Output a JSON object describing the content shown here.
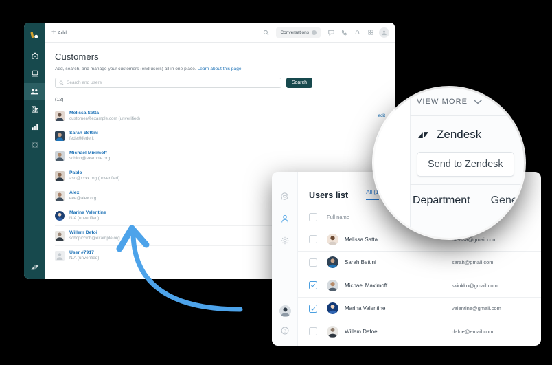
{
  "colors": {
    "nav_dark": "#17494d",
    "nav_active": "#2b5f63",
    "link_blue": "#1f73b7",
    "accent_blue": "#2b7cd3",
    "arrow_blue": "#4da3ea",
    "page_bg": "#000000"
  },
  "zendesk_window": {
    "nav": {
      "brand_icon": "zendesk-products-icon",
      "items": [
        {
          "icon": "home-icon",
          "name": "home",
          "active": false
        },
        {
          "icon": "views-icon",
          "name": "views",
          "active": false
        },
        {
          "icon": "customers-icon",
          "name": "customers",
          "active": true
        },
        {
          "icon": "organizations-icon",
          "name": "organizations",
          "active": false
        },
        {
          "icon": "reporting-icon",
          "name": "reporting",
          "active": false
        },
        {
          "icon": "admin-gear-icon",
          "name": "admin",
          "active": false
        }
      ],
      "footer_icon": "zendesk-logo-icon"
    },
    "topbar": {
      "add_label": "Add",
      "add_icon": "plus-icon",
      "search_icon": "search-icon",
      "conversations_label": "Conversations",
      "conversations_badge": "0",
      "icons": [
        "chat-icon",
        "phone-icon",
        "bell-icon",
        "apps-grid-icon"
      ],
      "avatar_icon": "user-avatar-icon"
    },
    "page": {
      "title": "Customers",
      "subtitle": "Add, search, and manage your customers (end users) all in one place.",
      "subtitle_link": "Learn about this page",
      "search_placeholder": "Search end users",
      "search_icon": "search-icon",
      "search_button": "Search",
      "count": "(12)",
      "edit_label": "edit",
      "customers": [
        {
          "name": "Melissa Satta",
          "email": "customer@example.com (unverified)",
          "edit": true,
          "avatar": "photo-woman-1"
        },
        {
          "name": "Sarah Bettini",
          "email": "fede@fede.it",
          "edit": true,
          "avatar": "photo-woman-2"
        },
        {
          "name": "Michael Miximoff",
          "email": "schiob@example.org",
          "edit": true,
          "avatar": "photo-man-1"
        },
        {
          "name": "Pablo",
          "email": "asd@xxxx.org (unverified)",
          "edit": false,
          "avatar": "photo-man-2"
        },
        {
          "name": "Alex",
          "email": "eee@alex.org",
          "edit": false,
          "avatar": "photo-man-3"
        },
        {
          "name": "Marina Valentine",
          "email": "N/A (unverified)",
          "edit": false,
          "avatar": "photo-woman-3"
        },
        {
          "name": "Willem Defoi",
          "email": "schcpicciob@example.org",
          "edit": false,
          "avatar": "photo-man-4"
        },
        {
          "name": "User #7917",
          "email": "N/A (unverified)",
          "edit": false,
          "avatar": "placeholder-user-icon"
        }
      ]
    }
  },
  "users_list_window": {
    "rail": {
      "icons": [
        "chat-bubble-icon",
        "users-icon",
        "settings-gear-icon"
      ],
      "selected_icon": "users-icon",
      "avatar_icon": "user-avatar-photo",
      "help_icon": "help-circle-icon"
    },
    "title": "Users list",
    "tab_active": "All (1",
    "tab_fragment": "line",
    "columns": {
      "name": "Full name"
    },
    "rows": [
      {
        "name": "Melissa Satta",
        "email": "meissa@gmail.com",
        "checked": false,
        "avatar": "photo-woman-1"
      },
      {
        "name": "Sarah Bettini",
        "email": "sarah@gmail.com",
        "checked": false,
        "avatar": "photo-woman-2"
      },
      {
        "name": "Michael Maximoff",
        "email": "skiokko@gmail.com",
        "checked": true,
        "avatar": "photo-man-1"
      },
      {
        "name": "Marina Valentine",
        "email": "valentine@gmail.com",
        "checked": true,
        "avatar": "photo-woman-3"
      },
      {
        "name": "Willem Dafoe",
        "email": "dafoe@email.com",
        "checked": false,
        "avatar": "photo-man-4"
      }
    ]
  },
  "magnifier": {
    "view_more_label": "VIEW MORE",
    "chevron_icon": "chevron-down-icon",
    "app_name": "Zendesk",
    "app_logo_icon": "zendesk-logo-icon",
    "send_button": "Send to Zendesk",
    "field_label": "Department",
    "field_value": "Gener",
    "edge_fragment": "line"
  },
  "annotation": {
    "arrow_icon": "curved-arrow-up-left"
  }
}
